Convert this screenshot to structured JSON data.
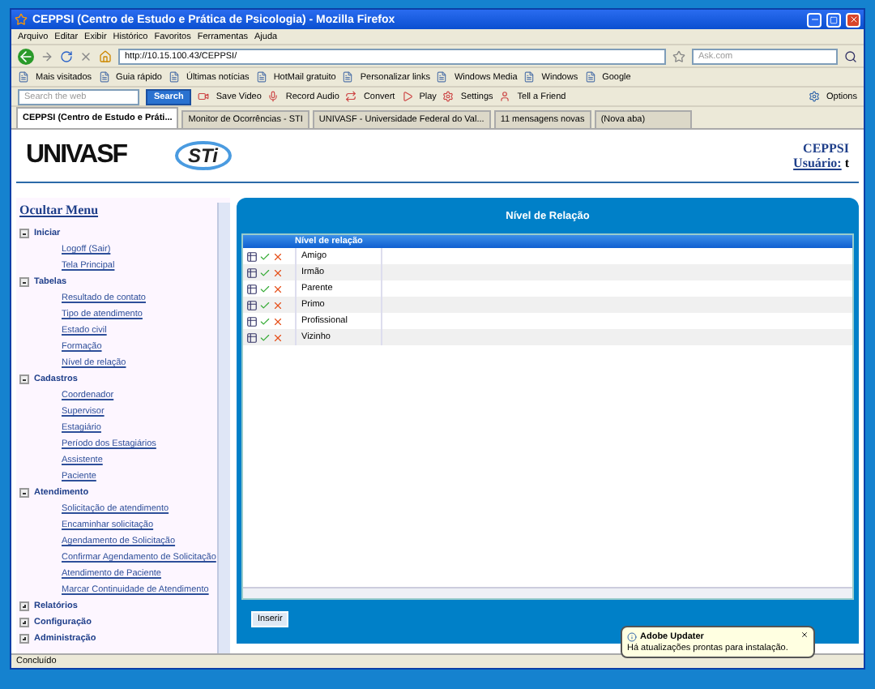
{
  "window": {
    "title": "CEPPSI (Centro de Estudo e Prática de Psicologia) - Mozilla Firefox"
  },
  "menu_bar": [
    "Arquivo",
    "Editar",
    "Exibir",
    "Histórico",
    "Favoritos",
    "Ferramentas",
    "Ajuda"
  ],
  "navigation": {
    "url": "http://10.15.100.43/CEPPSI/",
    "search_placeholder": "Ask.com"
  },
  "bookmarks": [
    "Mais visitados",
    "Guia rápido",
    "Últimas notícias",
    "HotMail gratuito",
    "Personalizar links",
    "Windows Media",
    "Windows",
    "Google"
  ],
  "toolbar": {
    "search_placeholder": "Search the web",
    "search_button": "Search",
    "items": [
      "Save Video",
      "Record Audio",
      "Convert",
      "Play",
      "Settings",
      "Tell a Friend"
    ],
    "options": "Options"
  },
  "tabs": [
    {
      "label": "CEPPSI (Centro de Estudo e Práti...",
      "selected": true
    },
    {
      "label": "Monitor de Ocorrências - STI",
      "selected": false
    },
    {
      "label": "UNIVASF - Universidade Federal do Val...",
      "selected": false
    },
    {
      "label": "11 mensagens novas",
      "selected": false
    },
    {
      "label": "(Nova aba)",
      "selected": false
    }
  ],
  "header": {
    "logos": [
      "UNIVASF",
      "STi"
    ],
    "site": "CEPPSI",
    "user_label": "Usuário:",
    "user": "t"
  },
  "sidebar": {
    "hide_menu": "Ocultar Menu",
    "groups": [
      {
        "label": "Iniciar",
        "expanded": true,
        "children": [
          "Logoff (Sair)",
          "Tela Principal"
        ]
      },
      {
        "label": "Tabelas",
        "expanded": true,
        "children": [
          "Resultado de contato",
          "Tipo de atendimento",
          "Estado civil",
          "Formação",
          "Nível de relação"
        ]
      },
      {
        "label": "Cadastros",
        "expanded": true,
        "children": [
          "Coordenador",
          "Supervisor",
          "Estagiário",
          "Período dos Estagiários",
          "Assistente",
          "Paciente"
        ]
      },
      {
        "label": "Atendimento",
        "expanded": true,
        "children": [
          "Solicitação de atendimento",
          "Encaminhar solicitação",
          "Agendamento de Solicitação",
          "Confirmar Agendamento de Solicitação",
          "Atendimento de Paciente",
          "Marcar Continuidade de Atendimento"
        ]
      },
      {
        "label": "Relatórios",
        "expanded": false
      },
      {
        "label": "Configuração",
        "expanded": false
      },
      {
        "label": "Administração",
        "expanded": false
      }
    ]
  },
  "main": {
    "title": "Nível de Relação",
    "column": "Nível de relação",
    "rows": [
      "Amigo",
      "Irmão",
      "Parente",
      "Primo",
      "Profissional",
      "Vizinho"
    ],
    "insert_button": "Inserir"
  },
  "notification": {
    "title": "Adobe Updater",
    "text": "Há atualizações prontas para instalação."
  },
  "status_bar": "Concluído"
}
